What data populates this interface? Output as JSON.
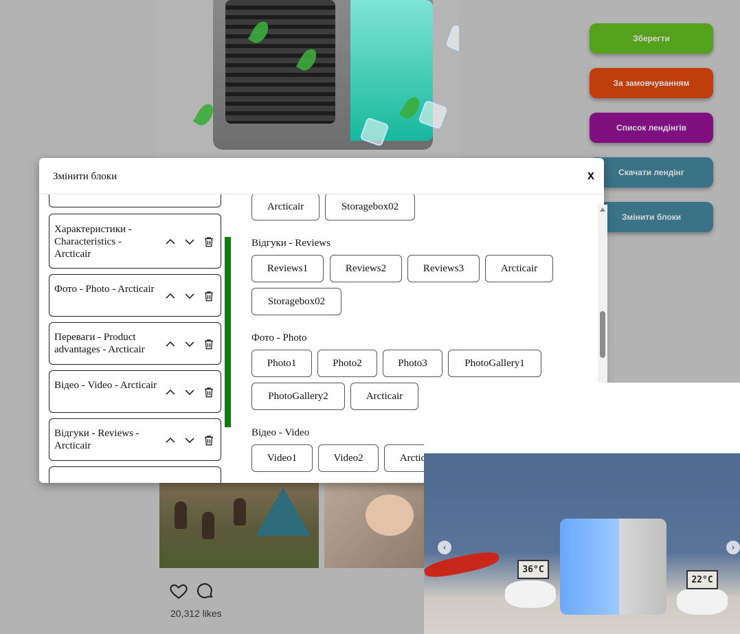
{
  "actions": {
    "save": "Зберегти",
    "default": "За замовчуванням",
    "list": "Список лендінгів",
    "download": "Скачати лендінг",
    "edit_blocks": "Змінити блоки"
  },
  "dialog": {
    "title": "Змінити блоки",
    "close": "x",
    "blocks": [
      {
        "label": "Характеристики - Characteristics - Arcticair"
      },
      {
        "label": "Фото - Photo - Arcticair"
      },
      {
        "label": "Переваги - Product advantages - Arcticair"
      },
      {
        "label": "Відео - Video - Arcticair"
      },
      {
        "label": "Відгуки - Reviews - Arcticair"
      }
    ],
    "sections": [
      {
        "title": "",
        "chips": [
          "Arcticair",
          "Storagebox02"
        ]
      },
      {
        "title": "Відгуки - Reviews",
        "chips": [
          "Reviews1",
          "Reviews2",
          "Reviews3",
          "Arcticair",
          "Storagebox02"
        ]
      },
      {
        "title": "Фото - Photo",
        "chips": [
          "Photo1",
          "Photo2",
          "Photo3",
          "PhotoGallery1",
          "PhotoGallery2",
          "Arcticair"
        ]
      },
      {
        "title": "Відео - Video",
        "chips": [
          "Video1",
          "Video2",
          "Arcticair"
        ]
      }
    ]
  },
  "feed": {
    "likes": "20,312 likes"
  },
  "promo": {
    "therm_left": "36°C",
    "therm_right": "22°C"
  },
  "colors": {
    "save": "#55a11c",
    "default": "#bf3e0b",
    "list": "#800f80",
    "download": "#3a7287",
    "accent_bar": "#0a7f0a"
  },
  "icons": {
    "up": "chevron-up-icon",
    "down": "chevron-down-icon",
    "delete": "trash-icon",
    "like": "heart-icon",
    "comment": "comment-icon"
  }
}
